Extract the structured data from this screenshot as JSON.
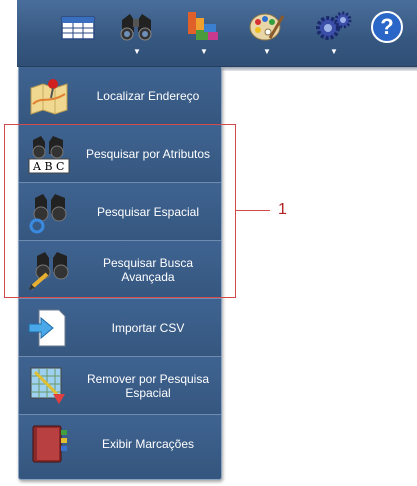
{
  "toolbar": {
    "buttons": [
      {
        "icon": "table-icon"
      },
      {
        "icon": "binoculars-icon",
        "arrow": "▼"
      },
      {
        "icon": "layers-icon",
        "arrow": "▼"
      },
      {
        "icon": "palette-icon",
        "arrow": "▼"
      },
      {
        "icon": "gears-icon",
        "arrow": "▼"
      },
      {
        "icon": "help-icon",
        "symbol": "?"
      }
    ]
  },
  "menu": {
    "items": [
      {
        "label": "Localizar Endereço",
        "icon": "map-pin-icon"
      },
      {
        "label": "Pesquisar por Atributos",
        "icon": "binoculars-abc-icon"
      },
      {
        "label": "Pesquisar Espacial",
        "icon": "binoculars-circle-icon"
      },
      {
        "label": "Pesquisar Busca Avançada",
        "icon": "binoculars-pencil-icon"
      },
      {
        "label": "Importar CSV",
        "icon": "import-file-icon"
      },
      {
        "label": "Remover por Pesquisa Espacial",
        "icon": "map-remove-icon"
      },
      {
        "label": "Exibir Marcações",
        "icon": "bookmarks-book-icon"
      }
    ]
  },
  "annotation": {
    "number": "1",
    "color": "#d24a4a"
  },
  "colors": {
    "toolbar": "#36577f",
    "menu": "#35577f",
    "menu_text": "#ffffff"
  }
}
